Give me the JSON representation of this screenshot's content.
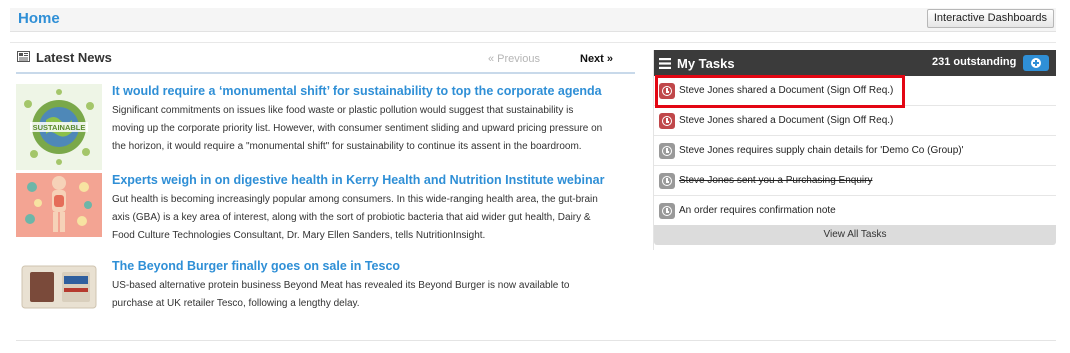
{
  "header": {
    "home_label": "Home",
    "dashboards_button": "Interactive Dashboards"
  },
  "news": {
    "title": "Latest News",
    "prev_label": "« Previous",
    "next_label": "Next »",
    "items": [
      {
        "title": "It would require a ‘monumental shift’ for sustainability to top the corporate agenda",
        "body": "Significant commitments on issues like food waste or plastic pollution would suggest that sustainability is moving up the corporate priority list. However, with consumer sentiment sliding and upward pricing pressure on the horizon, it would require a \"monumental shift\" for sustainability to continue its assent in the boardroom.",
        "thumb_label": "SUSTAINABLE"
      },
      {
        "title": "Experts weigh in on digestive health in Kerry Health and Nutrition Institute webinar",
        "body": "Gut health is becoming increasingly popular among consumers. In this wide-ranging health area, the gut-brain axis (GBA) is a key area of interest, along with the sort of probiotic bacteria that aid wider gut health, Dairy & Food Culture Technologies Consultant, Dr. Mary Ellen Sanders, tells NutritionInsight."
      },
      {
        "title": "The Beyond Burger finally goes on sale in Tesco",
        "body": "US-based alternative protein business Beyond Meat has revealed its Beyond Burger is now available to purchase at UK retailer Tesco, following a lengthy delay."
      }
    ]
  },
  "tasks": {
    "title": "My Tasks",
    "outstanding": "231 outstanding",
    "items": [
      {
        "text": "Steve Jones shared a Document (Sign Off Req.)",
        "status": "red",
        "strike": false
      },
      {
        "text": "Steve Jones shared a Document (Sign Off Req.)",
        "status": "red",
        "strike": false
      },
      {
        "text": "Steve Jones requires supply chain details for 'Demo Co (Group)'",
        "status": "grey",
        "strike": false
      },
      {
        "text": "Steve Jones sent you a Purchasing Enquiry",
        "status": "grey",
        "strike": true
      },
      {
        "text": "An order requires confirmation note",
        "status": "grey",
        "strike": false
      }
    ],
    "view_all": "View All Tasks"
  },
  "colors": {
    "link_blue": "#2f8fd6",
    "highlight_red": "#e30613",
    "task_red": "#c0474a",
    "task_grey": "#999999",
    "tasks_header": "#3b3b3b"
  }
}
